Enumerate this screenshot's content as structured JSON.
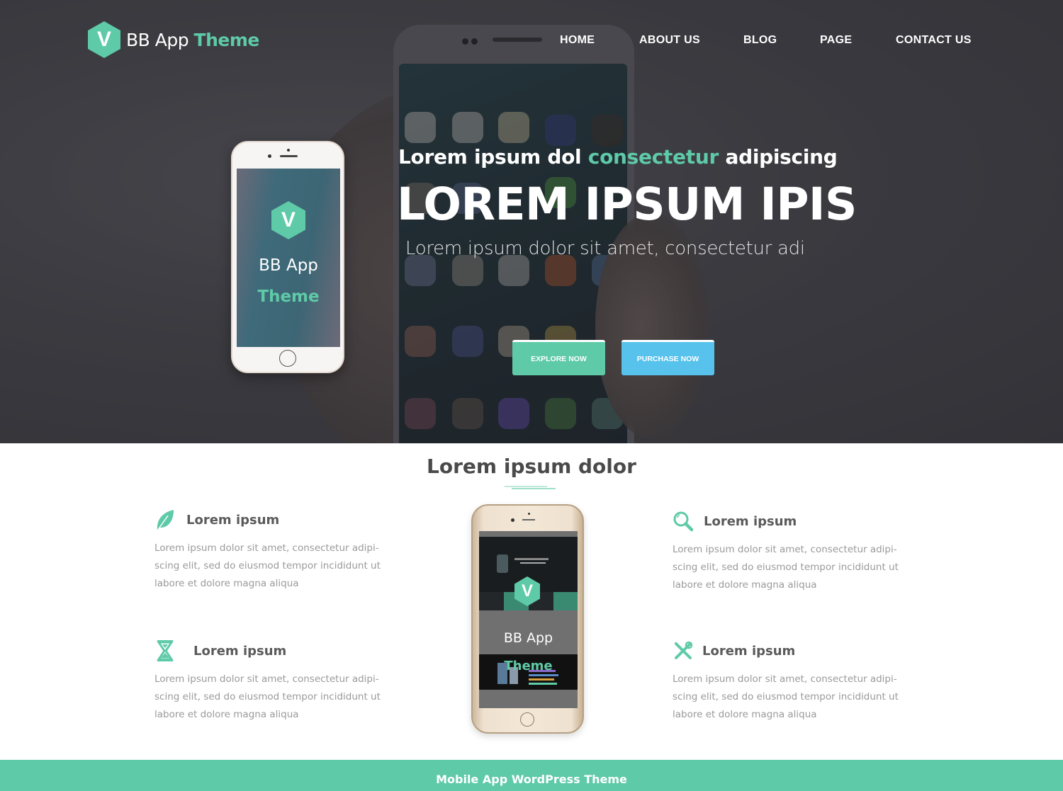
{
  "brand": {
    "logo_letter": "V",
    "name_part1": "BB App",
    "name_part2": "Theme",
    "accent_color": "#5ecaa7",
    "secondary_color": "#57c2ec"
  },
  "nav": {
    "items": [
      {
        "label": "HOME"
      },
      {
        "label": "ABOUT US"
      },
      {
        "label": "BLOG"
      },
      {
        "label": "PAGE"
      },
      {
        "label": "CONTACT US"
      }
    ]
  },
  "hero": {
    "tagline_before": "Lorem ipsum dol ",
    "tagline_accent": "consectetur",
    "tagline_after": " adipiscing",
    "title": "LOREM IPSUM IPIS",
    "description": "Lorem ipsum dolor sit amet, consectetur adi",
    "buttons": {
      "explore": "EXPLORE NOW",
      "purchase": "PURCHASE NOW"
    },
    "phone_mockup": {
      "logo_letter": "V",
      "title": "BB App",
      "subtitle": "Theme"
    }
  },
  "features": {
    "section_title": "Lorem ipsum dolor",
    "items": [
      {
        "icon": "leaf-icon",
        "title": "Lorem ipsum",
        "body": "Lorem ipsum dolor sit amet, consectetur adipi- scing elit, sed do eiusmod tempor incididunt ut labore et dolore magna aliqua"
      },
      {
        "icon": "hourglass-icon",
        "title": "Lorem ipsum",
        "body": "Lorem ipsum dolor sit amet, consectetur adipi- scing elit, sed do eiusmod tempor incididunt ut labore et dolore magna aliqua"
      },
      {
        "icon": "search-icon",
        "title": "Lorem ipsum",
        "body": "Lorem ipsum dolor sit amet, consectetur adipi- scing elit, sed do eiusmod tempor incididunt ut labore et dolore magna aliqua"
      },
      {
        "icon": "tools-icon",
        "title": "Lorem ipsum",
        "body": "Lorem ipsum dolor sit amet, consectetur adipi- scing elit, sed do eiusmod tempor incididunt ut labore et dolore magna aliqua"
      }
    ],
    "phone_mockup": {
      "logo_letter": "V",
      "title": "BB App",
      "subtitle": "Theme"
    }
  },
  "footer": {
    "text": "Mobile App WordPress Theme"
  }
}
